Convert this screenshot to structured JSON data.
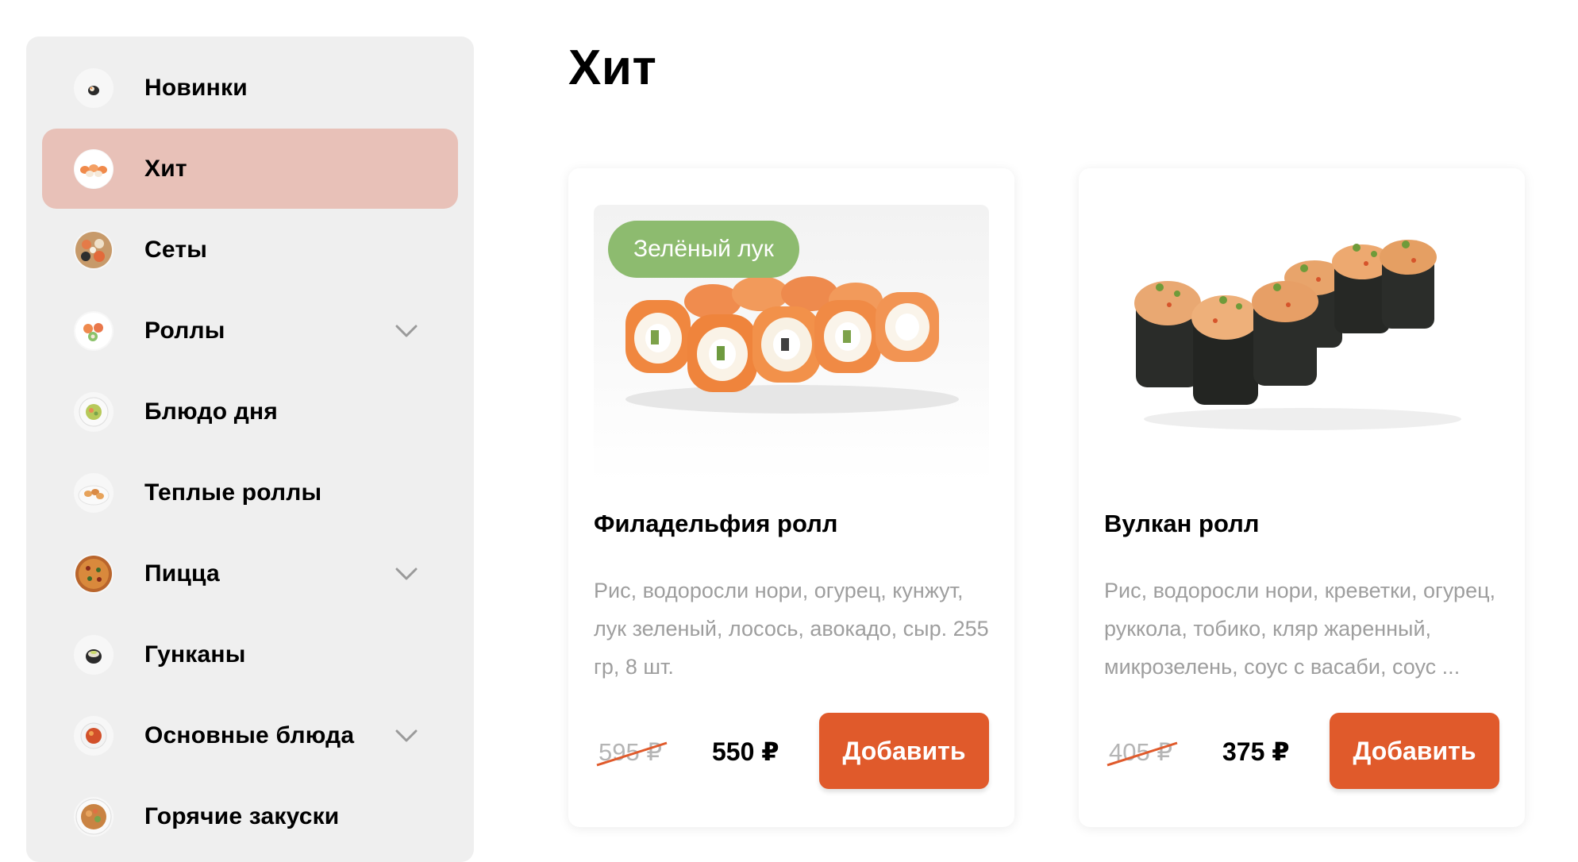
{
  "sidebar": {
    "items": [
      {
        "label": "Новинки",
        "icon": "sushi-roll-icon",
        "has_submenu": false,
        "active": false
      },
      {
        "label": "Хит",
        "icon": "hit-roll-plate-icon",
        "has_submenu": false,
        "active": true
      },
      {
        "label": "Сеты",
        "icon": "sushi-set-icon",
        "has_submenu": false,
        "active": false
      },
      {
        "label": "Роллы",
        "icon": "rolls-icon",
        "has_submenu": true,
        "active": false
      },
      {
        "label": "Блюдо дня",
        "icon": "dish-of-day-icon",
        "has_submenu": false,
        "active": false
      },
      {
        "label": "Теплые роллы",
        "icon": "warm-rolls-icon",
        "has_submenu": false,
        "active": false
      },
      {
        "label": "Пицца",
        "icon": "pizza-icon",
        "has_submenu": true,
        "active": false
      },
      {
        "label": "Гунканы",
        "icon": "gunkan-icon",
        "has_submenu": false,
        "active": false
      },
      {
        "label": "Основные блюда",
        "icon": "main-dish-icon",
        "has_submenu": true,
        "active": false
      },
      {
        "label": "Горячие закуски",
        "icon": "hot-snacks-icon",
        "has_submenu": false,
        "active": false
      }
    ]
  },
  "main": {
    "title": "Хит",
    "products": [
      {
        "name": "Филадельфия ролл",
        "tag": "Зелёный лук",
        "description": "Рис, водоросли нори, огурец, кунжут, лук зеленый, лосось, авокадо, сыр. 255 гр, 8 шт.",
        "old_price": "595 ₽",
        "price": "550 ₽",
        "button": "Добавить",
        "image": "philadelphia-roll-image"
      },
      {
        "name": "Вулкан ролл",
        "tag": "",
        "description": "Рис, водоросли нори, креветки, огурец, руккола, тобико, кляр жаренный, микрозелень, соус с васаби, соус ...",
        "old_price": "405 ₽",
        "price": "375 ₽",
        "button": "Добавить",
        "image": "volcano-roll-image"
      }
    ]
  },
  "colors": {
    "active_item": "#e8c1b8",
    "sidebar_bg": "#efefef",
    "button": "#e05a2b",
    "tag": "#8dbb6f",
    "strike": "#e05a2b"
  }
}
